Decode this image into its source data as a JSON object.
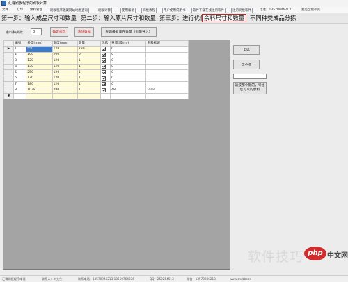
{
  "window": {
    "title": "汇馨刷板程序的刷板计算"
  },
  "menu": [
    {
      "label": "文件"
    },
    {
      "label": "打印"
    },
    {
      "label": "余料管理"
    },
    {
      "label": "刷板程序收藏网站地图查询"
    },
    {
      "label": "刷板计算"
    },
    {
      "label": "使用帮助"
    },
    {
      "label": "刷板教程"
    },
    {
      "label": "用户使用说明书"
    },
    {
      "label": "软件下载在线注册软件"
    },
    {
      "label": "注册刷板软件"
    },
    {
      "label": "电话：13570946213"
    },
    {
      "label": "我是全能小资"
    }
  ],
  "steps": {
    "step1": "第一步：输入成品尺寸和数量",
    "step2": "第二步：输入原片尺寸和数量",
    "step3": "第三步：进行优化",
    "active": "余料尺寸和数量",
    "step4": "不同种类成品分拣"
  },
  "params": {
    "remnant_label": "余料种类数：",
    "remnant_value": "0",
    "btn_confirm": "确定修改",
    "btn_clear": "清除数据",
    "btn_import": "查询最新库存数量（批量导入）"
  },
  "table": {
    "headers": [
      "编号",
      "长度(mm)",
      "宽度(mm)",
      "数量",
      "优选",
      "重量(吨/m²)",
      "余料标记"
    ],
    "rows": [
      {
        "marker": "▶",
        "id": "1",
        "len": "550",
        "wid": "128",
        "qty": "280",
        "prefer": true,
        "wt": "0",
        "mark": ""
      },
      {
        "marker": "",
        "id": "2",
        "len": "100",
        "wid": "200",
        "qty": "6",
        "prefer": true,
        "wt": "0",
        "mark": ""
      },
      {
        "marker": "",
        "id": "3",
        "len": "120",
        "wid": "120",
        "qty": "1",
        "prefer": true,
        "wt": "0",
        "mark": ""
      },
      {
        "marker": "",
        "id": "4",
        "len": "150",
        "wid": "120",
        "qty": "1",
        "prefer": true,
        "wt": "0",
        "mark": ""
      },
      {
        "marker": "",
        "id": "5",
        "len": "250",
        "wid": "120",
        "qty": "1",
        "prefer": true,
        "wt": "0",
        "mark": ""
      },
      {
        "marker": "",
        "id": "6",
        "len": "170",
        "wid": "120",
        "qty": "1",
        "prefer": true,
        "wt": "0",
        "mark": ""
      },
      {
        "marker": "",
        "id": "7",
        "len": "180",
        "wid": "120",
        "qty": "1",
        "prefer": true,
        "wt": "0",
        "mark": ""
      },
      {
        "marker": "",
        "id": "8",
        "len": "1078",
        "wid": "280",
        "qty": "1",
        "prefer": true,
        "wt": "48",
        "mark": "False"
      },
      {
        "marker": "✱",
        "id": "",
        "len": "",
        "wid": "",
        "qty": "",
        "prefer": false,
        "wt": "",
        "mark": ""
      }
    ]
  },
  "side": {
    "btn_all": "全选",
    "btn_clear_all": "全不选",
    "input_value": "",
    "btn_note": "请按那个键的，导出您可以的余料"
  },
  "watermark": {
    "cn": "软件技巧",
    "logo": "php",
    "site": "中文网"
  },
  "status": [
    {
      "text": "汇馨刷板程序电话"
    },
    {
      "text": "联系人：刘先生"
    },
    {
      "text": "联系电话：13570946213  18650764836"
    },
    {
      "text": "QQ：252254513"
    },
    {
      "text": "微信：13570946213"
    },
    {
      "text": "www.sncbbr.cn"
    }
  ]
}
